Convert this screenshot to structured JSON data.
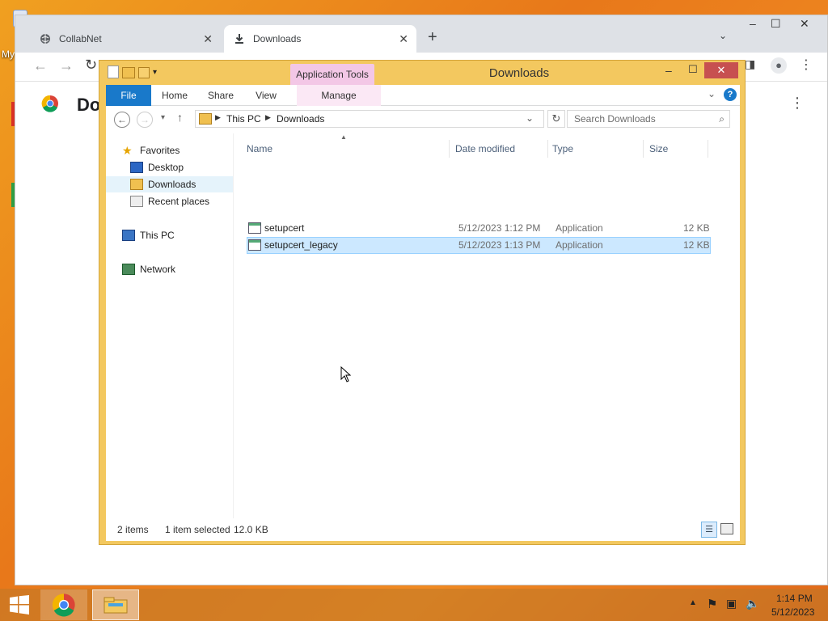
{
  "desktop": {
    "partial_icon_label": "My"
  },
  "chrome": {
    "tabs": [
      {
        "title": "CollabNet",
        "icon": "globe-icon",
        "active": false
      },
      {
        "title": "Downloads",
        "icon": "download-icon",
        "active": true
      }
    ],
    "new_tab_label": "+",
    "page_heading_partial": "Do"
  },
  "explorer": {
    "title": "Downloads",
    "context_tab_group": "Application Tools",
    "ribbon_tabs": [
      "File",
      "Home",
      "Share",
      "View",
      "Manage"
    ],
    "breadcrumb": [
      "This PC",
      "Downloads"
    ],
    "search_placeholder": "Search Downloads",
    "nav": {
      "favorites": "Favorites",
      "favorites_items": [
        "Desktop",
        "Downloads",
        "Recent places"
      ],
      "this_pc": "This PC",
      "network": "Network",
      "selected": "Downloads"
    },
    "columns": [
      "Name",
      "Date modified",
      "Type",
      "Size"
    ],
    "files": [
      {
        "name": "setupcert",
        "date": "5/12/2023 1:12 PM",
        "type": "Application",
        "size": "12 KB",
        "selected": false
      },
      {
        "name": "setupcert_legacy",
        "date": "5/12/2023 1:13 PM",
        "type": "Application",
        "size": "12 KB",
        "selected": true
      }
    ],
    "status": {
      "items": "2 items",
      "selection": "1 item selected",
      "size": "12.0 KB"
    }
  },
  "taskbar": {
    "time": "1:14 PM",
    "date": "5/12/2023"
  },
  "colors": {
    "file_tab": "#1979ca",
    "app_tools": "#f3c7e6",
    "explorer_frame": "#f3c85f",
    "selection": "#cce8ff"
  }
}
